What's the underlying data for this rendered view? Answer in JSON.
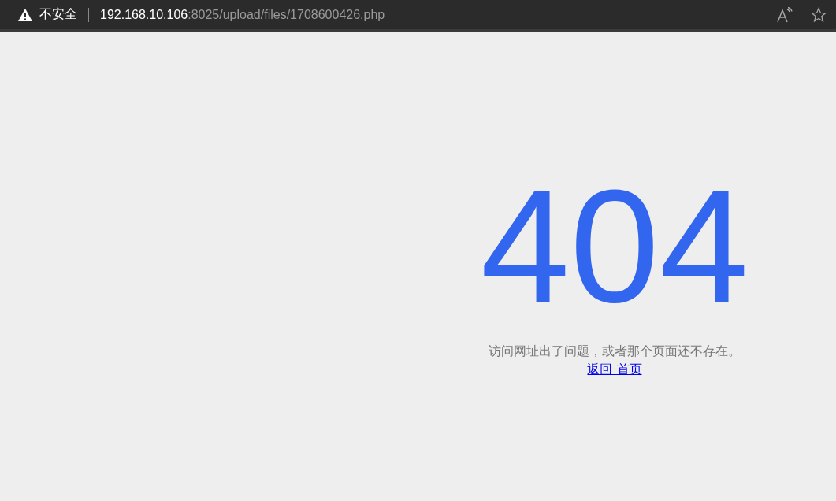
{
  "address_bar": {
    "security_label": "不安全",
    "host": "192.168.10.106",
    "path": ":8025/upload/files/1708600426.php"
  },
  "error_page": {
    "code": "404",
    "message": "访问网址出了问题，或者那个页面还不存在。",
    "link": "返回 首页"
  }
}
